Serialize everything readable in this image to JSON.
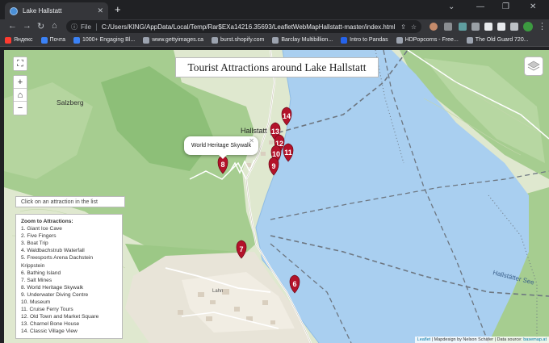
{
  "browser": {
    "tab_title": "Lake Hallstatt",
    "tab_close": "✕",
    "new_tab": "+",
    "file_label": "File",
    "url": "C:/Users/KING/AppData/Local/Temp/Rar$EXa14216.35693/LeafletWebMapHallstatt-master/index.html",
    "bookmarks": [
      {
        "label": "Яндекс",
        "color": "#ff3b30"
      },
      {
        "label": "Почта",
        "color": "#3b82f6"
      },
      {
        "label": "1000+ Engaging Bl...",
        "color": "#3b82f6"
      },
      {
        "label": "www.gettyimages.ca",
        "color": "#9ca3af"
      },
      {
        "label": "burst.shopify.com",
        "color": "#9ca3af"
      },
      {
        "label": "Barclay Multibillion...",
        "color": "#9ca3af"
      },
      {
        "label": "Intro to Pandas",
        "color": "#2563eb"
      },
      {
        "label": "HDPopcorns - Free...",
        "color": "#9ca3af"
      },
      {
        "label": "The Old Guard 720...",
        "color": "#9ca3af"
      }
    ]
  },
  "map": {
    "title": "Tourist Attractions around Lake Hallstatt",
    "hint": "Click on an attraction in the list",
    "zoom_heading": "Zoom to Attractions:",
    "attractions": [
      "1. Giant Ice Cave",
      "2. Five Fingers",
      "3. Boat Trip",
      "4. Waldbachstrub Waterfall",
      "5. Freesports Arena Dachstein Krippstein",
      "6. Bathing Island",
      "7. Salt Mines",
      "8. World Heritage Skywalk",
      "9. Underwater Diving Centre",
      "10. Museum",
      "11. Cruise Ferry Tours",
      "12. Old Town and Market Square",
      "13. Charnel Bone House",
      "14. Classic Village View"
    ],
    "popup_text": "World Heritage Skywalk",
    "popup_close": "✕",
    "zoom_in": "+",
    "zoom_out": "−",
    "place_labels": {
      "hallstatt": "Hallstatt",
      "salzberg": "Salzberg",
      "hallstatter_see": "Hallstätter See",
      "lahn": "Lahn"
    },
    "markers": [
      "14",
      "13",
      "12",
      "10",
      "11",
      "9",
      "8",
      "7",
      "6"
    ],
    "attribution": {
      "leaflet": "Leaflet",
      "design": "Mapdesign by Nelson Schäfer",
      "source_label": "Data source:",
      "source_link": "basemap.at"
    },
    "colors": {
      "lake": "#a9cff0",
      "forest": "#a6cd90",
      "marker": "#b3122a"
    }
  }
}
